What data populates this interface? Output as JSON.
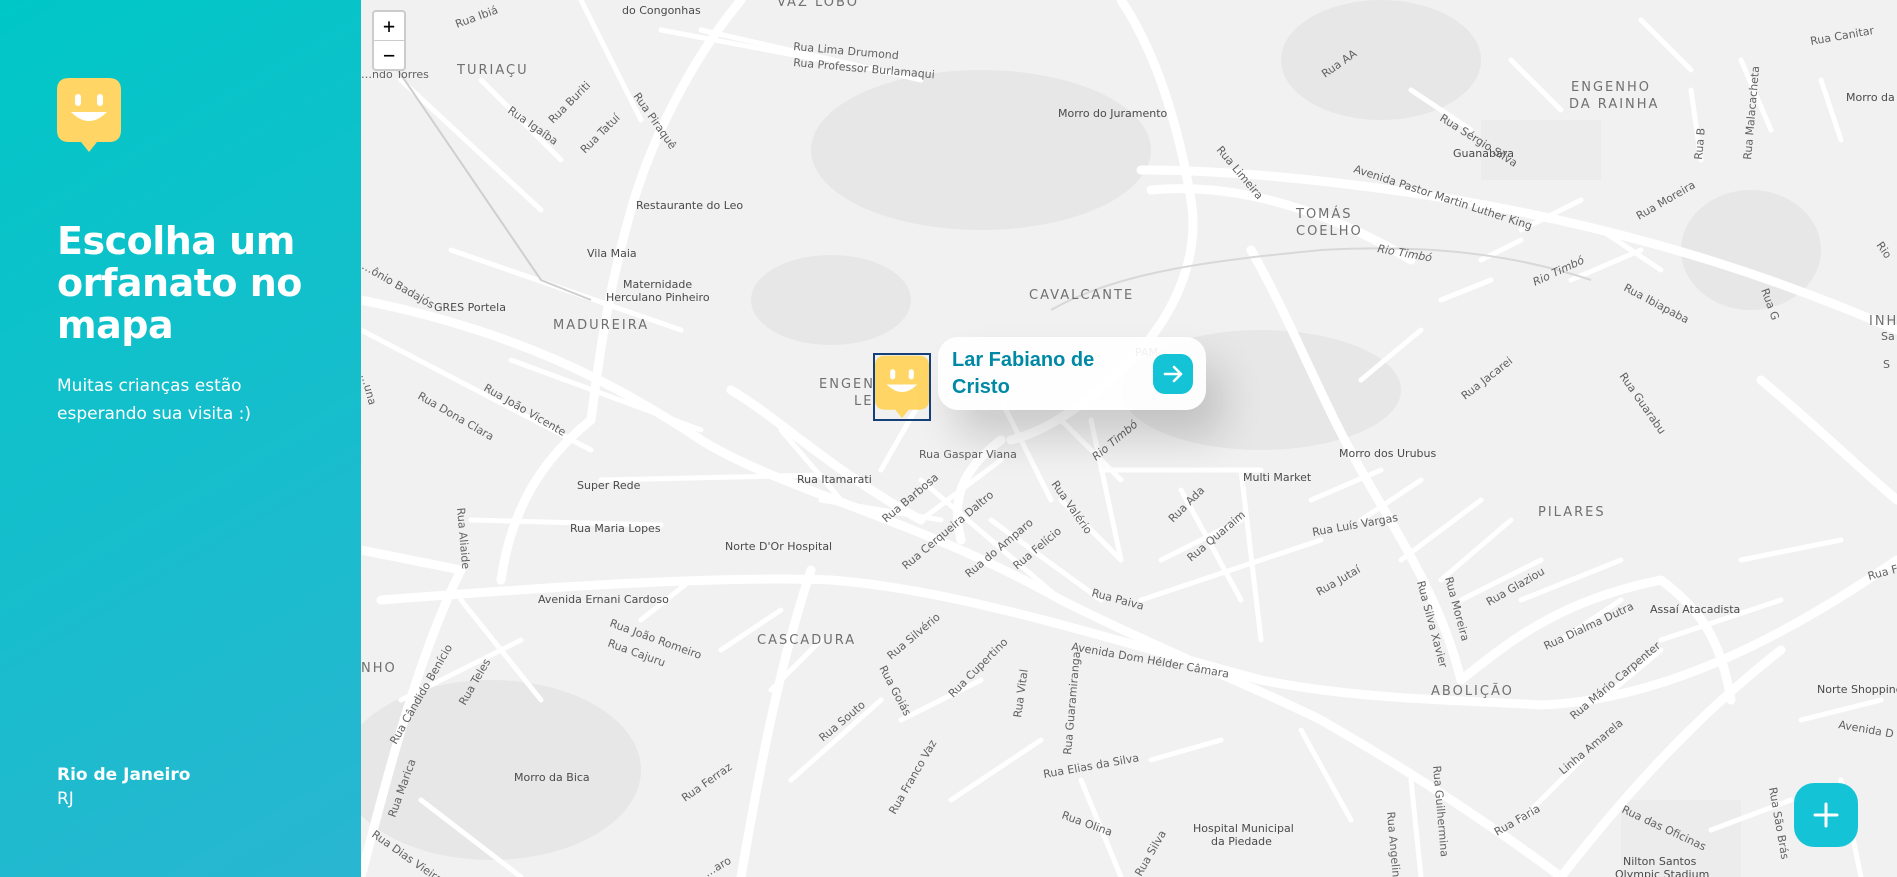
{
  "sidebar": {
    "title": "Escolha um orfanato no mapa",
    "subtitle": "Muitas crianças estão esperando sua visita :)",
    "city": "Rio de Janeiro",
    "state": "RJ"
  },
  "map": {
    "zoom_in": "+",
    "zoom_out": "−",
    "popup": {
      "name": "Lar Fabiano de Cristo"
    },
    "districts": [
      "TURIAÇU",
      "MADUREIRA",
      "CAVALCANTE",
      "ENGENHO DA RAINHA",
      "TOMÁS COELHO",
      "ENGEN… LE…",
      "CASCADURA",
      "PILARES",
      "ABOLIÇÃO",
      "INHAÚ…",
      "…NHO",
      "VAZ LOBO"
    ],
    "streets": [
      "Rua Ibiá",
      "do Congonhas",
      "Rua Lima Drumond",
      "Rua Professor Burlamaqui",
      "…ndo Torres",
      "Rua Igaíba",
      "Rua Buriti",
      "Rua Tatuí",
      "Rua Piraquê",
      "Rua AA",
      "Morro do Juramento",
      "Rua Sérgio Silva",
      "Guanabara",
      "Rua Canitar",
      "Morro da…",
      "Rua Malacacheta",
      "Rua B",
      "Rua Limeira",
      "Avenida Pastor Martin Luther King",
      "Rua Moreira",
      "Restaurante do Leo",
      "Vila Maia",
      "Maternidade Herculano Pinheiro",
      "…ônio Badajós",
      "GRES Portela",
      "Rio Timbó",
      "Rua Ibiapaba",
      "Rua G",
      "…una",
      "Rua Dona Clara",
      "Rua João Vicente",
      "PAM… …canti",
      "Rio Timbó",
      "Rua Jacarei",
      "Rua Guarabu",
      "Rua Gaspar Viana",
      "Morro dos Urubus",
      "Super Rede",
      "Rua Itamarati",
      "Rua Barbosa",
      "Multi Market",
      "Rua Ada",
      "Rua Aliaide",
      "Rua Maria Lopes",
      "Rua Cerqueira Daltro",
      "Rua do Amparo",
      "Rua Valério",
      "Rua Felício",
      "Rua Quaraim",
      "Rua Luís Vargas",
      "Norte D'Or Hospital",
      "Avenida Ernani Cardoso",
      "Rua Paiva",
      "Rua Jutaí",
      "Rua Silva Xavier",
      "Rua Moreira",
      "Rua Glaziou",
      "Assaí Atacadista",
      "Rua Fa…",
      "Rua João Romeiro",
      "Rua Cajuru",
      "Rua Silvério",
      "Avenida Dom Hélder Câmara",
      "Rua Dialma Dutra",
      "Rua Cândido Benício",
      "Rua Teles",
      "Rua Goiás",
      "Rua Cupertino",
      "Rua Vital",
      "Rua Guaramiranga",
      "Rua Mário Carpenter",
      "Norte Shopping",
      "Avenida D…",
      "Rua Souto",
      "Linha Amarela",
      "Rua Ferraz",
      "Rua Franco Vaz",
      "Rua Elias da Silva",
      "Morro da Bica",
      "Rua Marica",
      "Rua Olina",
      "Hospital Municipal da Piedade",
      "Rua Guilhermina",
      "Rua Angelina",
      "Rua Faria",
      "Rua das Oficinas",
      "Rua São Brás",
      "Rua Dias Vieira",
      "…aro",
      "Rua Silva",
      "Nilton Santos Olympic Stadium"
    ]
  }
}
